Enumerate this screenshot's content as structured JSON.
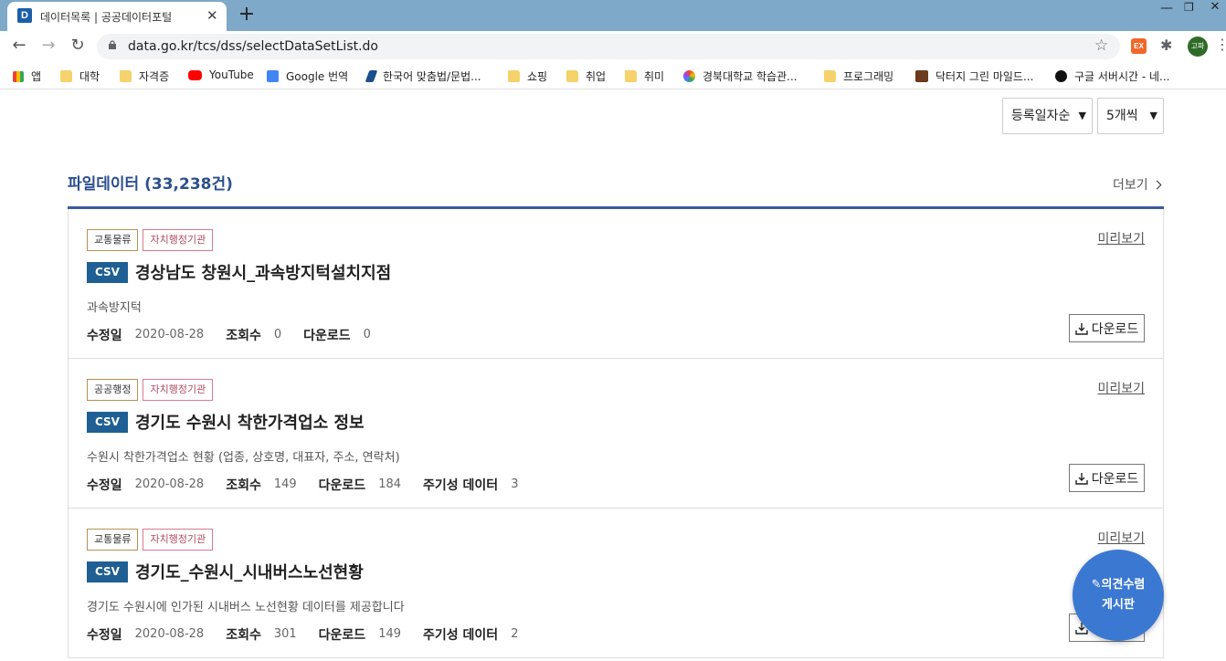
{
  "browser": {
    "tab_title": "데이터목록 | 공공데이터포털",
    "tab_favicon": "D",
    "url": "data.go.kr/tcs/dss/selectDataSetList.do",
    "new_tab_label": "+",
    "profile_label": "고파",
    "extension_label": "EX",
    "bookmarks": [
      {
        "label": "앱",
        "icon": "apps-grid-icon"
      },
      {
        "label": "대학",
        "icon": "folder-icon"
      },
      {
        "label": "자격증",
        "icon": "folder-icon"
      },
      {
        "label": "YouTube",
        "icon": "youtube-icon"
      },
      {
        "label": "Google 번역",
        "icon": "google-translate-icon"
      },
      {
        "label": "한국어 맞춤법/문법...",
        "icon": "spellcheck-icon"
      },
      {
        "label": "쇼핑",
        "icon": "folder-icon"
      },
      {
        "label": "취업",
        "icon": "folder-icon"
      },
      {
        "label": "취미",
        "icon": "folder-icon"
      },
      {
        "label": "경북대학교 학습관...",
        "icon": "knu-icon"
      },
      {
        "label": "프로그래밍",
        "icon": "folder-icon"
      },
      {
        "label": "닥터지 그린 마일드...",
        "icon": "drg-icon"
      },
      {
        "label": "구글 서버시간 - 네...",
        "icon": "clock-icon"
      }
    ]
  },
  "filters": {
    "sort": "등록일자순",
    "count": "5개씩"
  },
  "section": {
    "title": "파일데이터",
    "count": "(33,238건)",
    "more": "더보기"
  },
  "labels": {
    "preview": "미리보기",
    "download": "다운로드",
    "modified": "수정일",
    "views": "조회수",
    "downloads": "다운로드",
    "periodic": "주기성 데이터"
  },
  "items": [
    {
      "tags": [
        "교통물류",
        "자치행정기관"
      ],
      "format": "CSV",
      "title": "경상남도 창원시_과속방지턱설치지점",
      "desc": "과속방지턱",
      "modified": "2020-08-28",
      "views": "0",
      "downloads": "0",
      "periodic": ""
    },
    {
      "tags": [
        "공공행정",
        "자치행정기관"
      ],
      "format": "CSV",
      "title": "경기도 수원시 착한가격업소 정보",
      "desc": "수원시 착한가격업소 현황 (업종, 상호명, 대표자, 주소, 연락처)",
      "modified": "2020-08-28",
      "views": "149",
      "downloads": "184",
      "periodic": "3"
    },
    {
      "tags": [
        "교통물류",
        "자치행정기관"
      ],
      "format": "CSV",
      "title": "경기도_수원시_시내버스노선현황",
      "desc": "경기도 수원시에 인가된 시내버스 노선현황 데이터를 제공합니다",
      "modified": "2020-08-28",
      "views": "301",
      "downloads": "149",
      "periodic": "2"
    }
  ],
  "fab": {
    "line1": "의견수렴",
    "line2": "게시판"
  }
}
